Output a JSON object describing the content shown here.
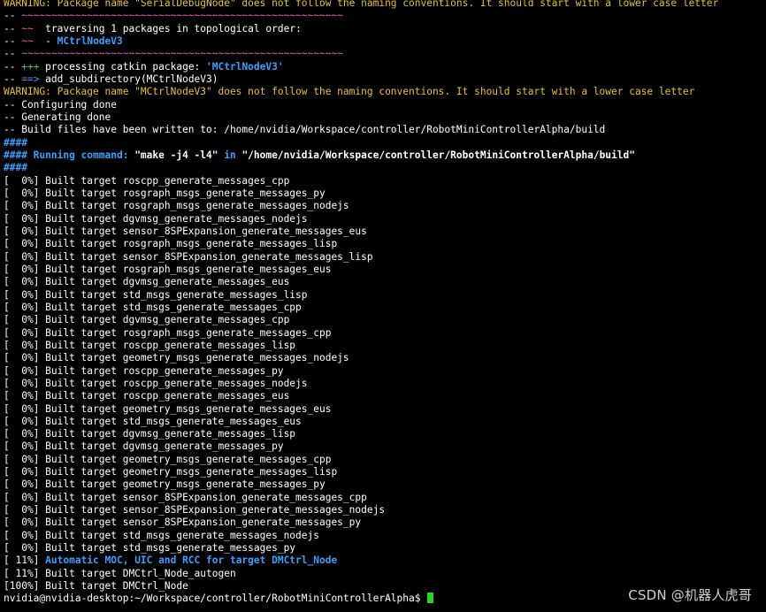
{
  "colors": {
    "background": "#000000",
    "default_text": "#ffffff",
    "warning": "#e6c229",
    "magenta": "#ff4fb8",
    "green": "#3fd13f",
    "blue": "#3aa0ff",
    "cursor": "#22d622",
    "watermark": "#cfcfcf"
  },
  "terminal": {
    "lines": [
      [
        {
          "t": "WARNING: Package name \"SerialDebugNode\" does not follow the naming conventions. It should start with a lower case letter",
          "c": "#e6c229"
        }
      ],
      [
        {
          "t": "-- ",
          "c": "#ffffff"
        },
        {
          "t": "~~~~~~~~~~~~~~~~~~~~~~~~~~~~~~~~~~~~~~~~~~~~~~~~~~~~~~",
          "c": "#ff4fb8"
        }
      ],
      [
        {
          "t": "-- ",
          "c": "#ffffff"
        },
        {
          "t": "~~",
          "c": "#ff4fb8"
        },
        {
          "t": "  traversing 1 packages in topological order:",
          "c": "#ffffff"
        }
      ],
      [
        {
          "t": "-- ",
          "c": "#ffffff"
        },
        {
          "t": "~~",
          "c": "#ff4fb8"
        },
        {
          "t": "  - ",
          "c": "#ffffff"
        },
        {
          "t": "MCtrlNodeV3",
          "c": "#3aa0ff",
          "b": true
        }
      ],
      [
        {
          "t": "-- ",
          "c": "#ffffff"
        },
        {
          "t": "~~~~~~~~~~~~~~~~~~~~~~~~~~~~~~~~~~~~~~~~~~~~~~~~~~~~~~",
          "c": "#ff4fb8"
        }
      ],
      [
        {
          "t": "-- ",
          "c": "#ffffff"
        },
        {
          "t": "+++",
          "c": "#3fd13f"
        },
        {
          "t": " processing catkin package: ",
          "c": "#ffffff"
        },
        {
          "t": "'MCtrlNodeV3'",
          "c": "#3aa0ff",
          "b": true
        }
      ],
      [
        {
          "t": "-- ",
          "c": "#ffffff"
        },
        {
          "t": "==>",
          "c": "#3aa0ff"
        },
        {
          "t": " add_subdirectory(MCtrlNodeV3)",
          "c": "#ffffff"
        }
      ],
      [
        {
          "t": "WARNING: Package name \"MCtrlNodeV3\" does not follow the naming conventions. It should start with a lower case letter",
          "c": "#e6c229"
        }
      ],
      [
        {
          "t": "-- Configuring done",
          "c": "#ffffff"
        }
      ],
      [
        {
          "t": "-- Generating done",
          "c": "#ffffff"
        }
      ],
      [
        {
          "t": "-- Build files have been written to: /home/nvidia/Workspace/controller/RobotMiniControllerAlpha/build",
          "c": "#ffffff"
        }
      ],
      [
        {
          "t": "####",
          "c": "#3aa0ff",
          "b": true
        }
      ],
      [
        {
          "t": "#### Running command: ",
          "c": "#3aa0ff",
          "b": true
        },
        {
          "t": "\"make -j4 -l4\"",
          "c": "#ffffff",
          "b": true
        },
        {
          "t": " in ",
          "c": "#3aa0ff",
          "b": true
        },
        {
          "t": "\"/home/nvidia/Workspace/controller/RobotMiniControllerAlpha/build\"",
          "c": "#ffffff",
          "b": true
        }
      ],
      [
        {
          "t": "####",
          "c": "#3aa0ff",
          "b": true
        }
      ],
      [
        {
          "t": "[  0%] Built target roscpp_generate_messages_cpp",
          "c": "#ffffff"
        }
      ],
      [
        {
          "t": "[  0%] Built target rosgraph_msgs_generate_messages_py",
          "c": "#ffffff"
        }
      ],
      [
        {
          "t": "[  0%] Built target rosgraph_msgs_generate_messages_nodejs",
          "c": "#ffffff"
        }
      ],
      [
        {
          "t": "[  0%] Built target dgvmsg_generate_messages_nodejs",
          "c": "#ffffff"
        }
      ],
      [
        {
          "t": "[  0%] Built target sensor_8SPExpansion_generate_messages_eus",
          "c": "#ffffff"
        }
      ],
      [
        {
          "t": "[  0%] Built target rosgraph_msgs_generate_messages_lisp",
          "c": "#ffffff"
        }
      ],
      [
        {
          "t": "[  0%] Built target sensor_8SPExpansion_generate_messages_lisp",
          "c": "#ffffff"
        }
      ],
      [
        {
          "t": "[  0%] Built target rosgraph_msgs_generate_messages_eus",
          "c": "#ffffff"
        }
      ],
      [
        {
          "t": "[  0%] Built target dgvmsg_generate_messages_eus",
          "c": "#ffffff"
        }
      ],
      [
        {
          "t": "[  0%] Built target std_msgs_generate_messages_lisp",
          "c": "#ffffff"
        }
      ],
      [
        {
          "t": "[  0%] Built target std_msgs_generate_messages_cpp",
          "c": "#ffffff"
        }
      ],
      [
        {
          "t": "[  0%] Built target dgvmsg_generate_messages_cpp",
          "c": "#ffffff"
        }
      ],
      [
        {
          "t": "[  0%] Built target rosgraph_msgs_generate_messages_cpp",
          "c": "#ffffff"
        }
      ],
      [
        {
          "t": "[  0%] Built target roscpp_generate_messages_lisp",
          "c": "#ffffff"
        }
      ],
      [
        {
          "t": "[  0%] Built target geometry_msgs_generate_messages_nodejs",
          "c": "#ffffff"
        }
      ],
      [
        {
          "t": "[  0%] Built target roscpp_generate_messages_py",
          "c": "#ffffff"
        }
      ],
      [
        {
          "t": "[  0%] Built target roscpp_generate_messages_nodejs",
          "c": "#ffffff"
        }
      ],
      [
        {
          "t": "[  0%] Built target roscpp_generate_messages_eus",
          "c": "#ffffff"
        }
      ],
      [
        {
          "t": "[  0%] Built target geometry_msgs_generate_messages_eus",
          "c": "#ffffff"
        }
      ],
      [
        {
          "t": "[  0%] Built target std_msgs_generate_messages_eus",
          "c": "#ffffff"
        }
      ],
      [
        {
          "t": "[  0%] Built target dgvmsg_generate_messages_lisp",
          "c": "#ffffff"
        }
      ],
      [
        {
          "t": "[  0%] Built target dgvmsg_generate_messages_py",
          "c": "#ffffff"
        }
      ],
      [
        {
          "t": "[  0%] Built target geometry_msgs_generate_messages_cpp",
          "c": "#ffffff"
        }
      ],
      [
        {
          "t": "[  0%] Built target geometry_msgs_generate_messages_lisp",
          "c": "#ffffff"
        }
      ],
      [
        {
          "t": "[  0%] Built target geometry_msgs_generate_messages_py",
          "c": "#ffffff"
        }
      ],
      [
        {
          "t": "[  0%] Built target sensor_8SPExpansion_generate_messages_cpp",
          "c": "#ffffff"
        }
      ],
      [
        {
          "t": "[  0%] Built target sensor_8SPExpansion_generate_messages_nodejs",
          "c": "#ffffff"
        }
      ],
      [
        {
          "t": "[  0%] Built target sensor_8SPExpansion_generate_messages_py",
          "c": "#ffffff"
        }
      ],
      [
        {
          "t": "[  0%] Built target std_msgs_generate_messages_nodejs",
          "c": "#ffffff"
        }
      ],
      [
        {
          "t": "[  0%] Built target std_msgs_generate_messages_py",
          "c": "#ffffff"
        }
      ],
      [
        {
          "t": "[ 11%] ",
          "c": "#ffffff"
        },
        {
          "t": "Automatic MOC, UIC and RCC for target DMCtrl_Node",
          "c": "#3aa0ff",
          "b": true
        }
      ],
      [
        {
          "t": "[ 11%] Built target DMCtrl_Node_autogen",
          "c": "#ffffff"
        }
      ],
      [
        {
          "t": "[100%] Built target DMCtrl_Node",
          "c": "#ffffff"
        }
      ]
    ],
    "prompt": "nvidia@nvidia-desktop:~/Workspace/controller/RobotMiniControllerAlpha$ "
  },
  "watermark": "CSDN @机器人虎哥"
}
